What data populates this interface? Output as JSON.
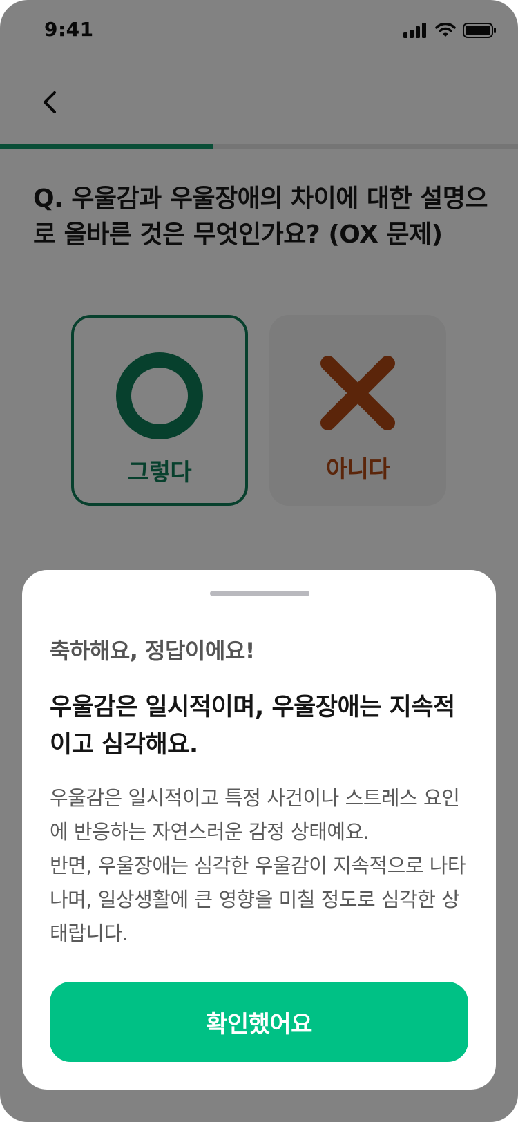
{
  "status_bar": {
    "time": "9:41",
    "icons": [
      "signal-icon",
      "wifi-icon",
      "battery-icon"
    ]
  },
  "nav": {
    "back_icon": "chevron-left-icon"
  },
  "progress": {
    "value": 0.41,
    "color": "#149a6c"
  },
  "question": {
    "text": "Q. 우울감과 우울장애의 차이에 대한 설명으로 올바른 것은 무엇인가요? (OX 문제)"
  },
  "choices": [
    {
      "id": "o",
      "icon": "circle-o-icon",
      "label": "그렇다",
      "selected": true,
      "color": "#0f7e59"
    },
    {
      "id": "x",
      "icon": "cross-x-icon",
      "label": "아니다",
      "selected": false,
      "color": "#b24a14"
    }
  ],
  "sheet": {
    "status": "축하해요, 정답이에요!",
    "answer": "우울감은 일시적이며, 우울장애는 지속적이고 심각해요.",
    "explanation": "우울감은 일시적이고 특정 사건이나 스트레스 요인에 반응하는 자연스러운 감정 상태예요.\n반면, 우울장애는 심각한 우울감이 지속적으로 나타나며, 일상생활에 큰 영향을 미칠 정도로 심각한 상태랍니다.",
    "confirm_label": "확인했어요",
    "accent": "#00c185"
  }
}
